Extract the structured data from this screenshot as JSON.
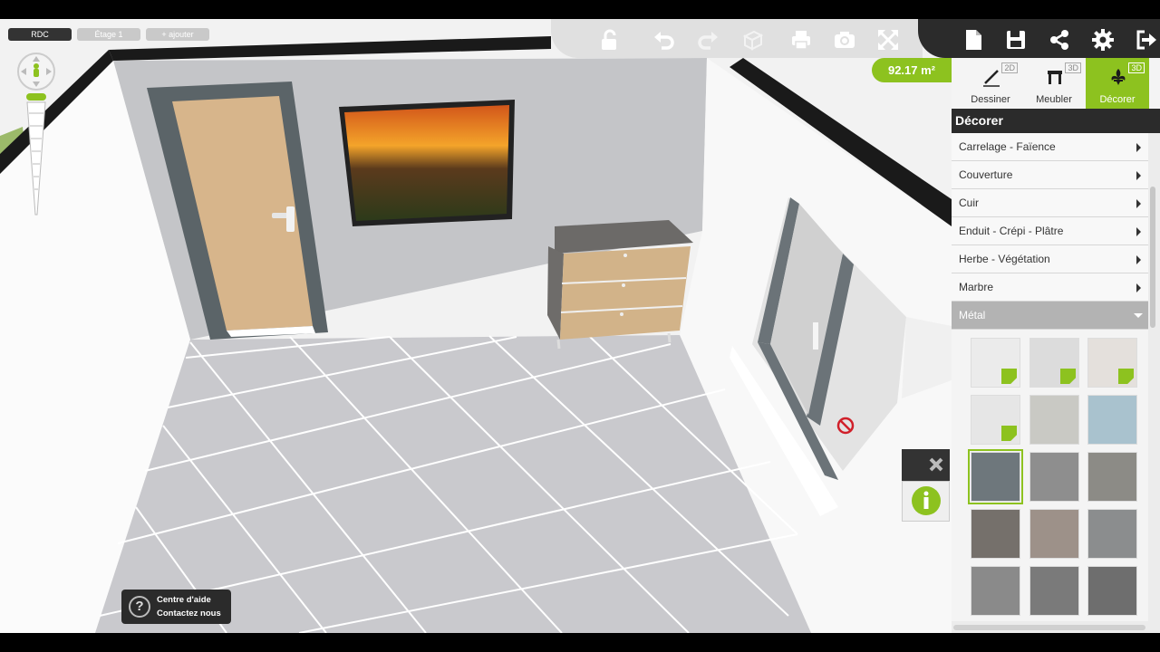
{
  "floors": {
    "tabs": [
      "RDC",
      "Étage 1",
      "+ ajouter"
    ],
    "active": 0
  },
  "toolbar": {
    "left_icons": [
      "unlock-icon",
      "undo-icon",
      "redo-icon",
      "3d-box-icon",
      "print-icon",
      "camera-icon",
      "fullscreen-icon"
    ],
    "right_icons": [
      "new-file-icon",
      "save-icon",
      "share-icon",
      "settings-icon",
      "logout-icon"
    ]
  },
  "area_badge": "92.17 m²",
  "modes": [
    {
      "label": "Dessiner",
      "tag": "2D",
      "icon": "pencil-icon"
    },
    {
      "label": "Meubler",
      "tag": "3D",
      "icon": "table-icon"
    },
    {
      "label": "Décorer",
      "tag": "3D",
      "icon": "fleur-de-lis-icon",
      "active": true
    }
  ],
  "panel": {
    "title": "Décorer",
    "categories": [
      {
        "label": "Carrelage - Faïence"
      },
      {
        "label": "Couverture"
      },
      {
        "label": "Cuir"
      },
      {
        "label": "Enduit - Crépi - Plâtre"
      },
      {
        "label": "Herbe - Végétation"
      },
      {
        "label": "Marbre"
      },
      {
        "label": "Métal",
        "open": true
      }
    ],
    "swatches": [
      {
        "color": "#ebebeb",
        "custom": true
      },
      {
        "color": "#dcdcdc",
        "custom": true
      },
      {
        "color": "#e4e0dc",
        "custom": true
      },
      {
        "color": "#e6e6e6",
        "custom": true
      },
      {
        "color": "#c9c9c4"
      },
      {
        "color": "#a9c2ce"
      },
      {
        "color": "#6e777c",
        "selected": true
      },
      {
        "color": "#8e8e8e"
      },
      {
        "color": "#8c8b86"
      },
      {
        "color": "#75706b"
      },
      {
        "color": "#9d9189"
      },
      {
        "color": "#8b8d8e"
      },
      {
        "color": "#8a8a8a"
      },
      {
        "color": "#7a7a7a"
      },
      {
        "color": "#6e6e6e"
      }
    ]
  },
  "help": {
    "line1": "Centre d'aide",
    "line2": "Contactez nous"
  },
  "colors": {
    "accent": "#8dc21f",
    "dark": "#2b2b2b"
  }
}
